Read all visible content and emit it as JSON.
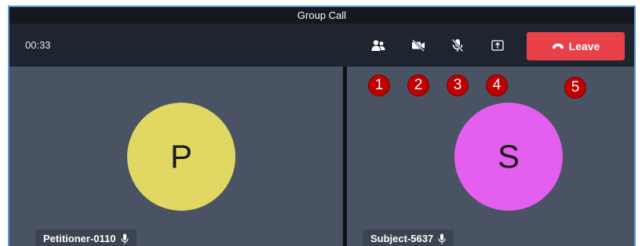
{
  "window": {
    "title": "Group Call"
  },
  "toolbar": {
    "timer": "00:33",
    "participants_icon": "participants-icon",
    "video_icon": "video-off-icon",
    "mic_icon": "mic-off-icon",
    "share_icon": "share-screen-icon",
    "leave_label": "Leave",
    "leave_icon": "phone-hangup-icon"
  },
  "participants": [
    {
      "name": "Petitioner-0110",
      "initial": "P",
      "color": "#e0d862",
      "mic_icon": "mic-icon"
    },
    {
      "name": "Subject-5637",
      "initial": "S",
      "color": "#e45fef",
      "mic_icon": "mic-icon"
    }
  ],
  "annotations": [
    "1",
    "2",
    "3",
    "4",
    "5"
  ],
  "colors": {
    "leave_button": "#e8414a",
    "tile_background": "#4a5363",
    "badge": "#c00000"
  }
}
